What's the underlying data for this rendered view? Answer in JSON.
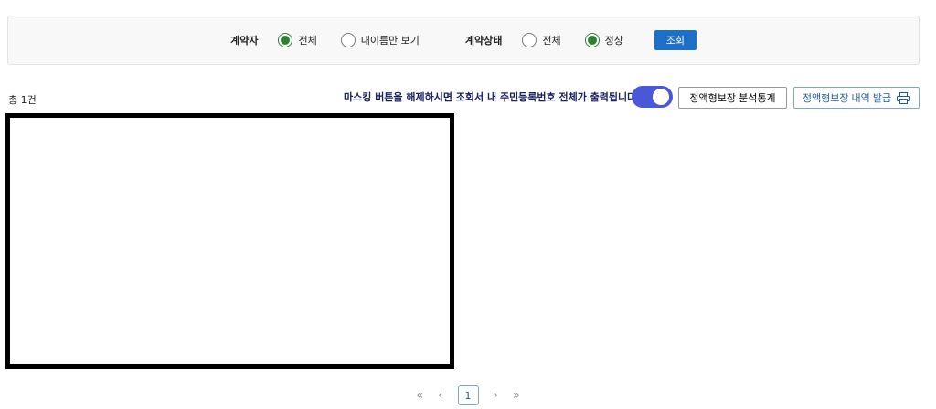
{
  "filter": {
    "contractor_label": "계약자",
    "contractor_options": [
      "전체",
      "내이름만 보기"
    ],
    "contractor_selected": 0,
    "status_label": "계약상태",
    "status_options": [
      "전체",
      "정상"
    ],
    "status_selected": 1,
    "search_button": "조회"
  },
  "total": "총 1건",
  "notice": "마스킹 버튼을 해제하시면 조회서 내 주민등록번호 전체가 출력됩니다.",
  "masking_toggle_on": true,
  "stats_button": "정액형보장 분석통계",
  "issue_button": "정액형보장 내역 발급",
  "pagination": {
    "first": "«",
    "prev": "‹",
    "current": "1",
    "next": "›",
    "last": "»"
  }
}
